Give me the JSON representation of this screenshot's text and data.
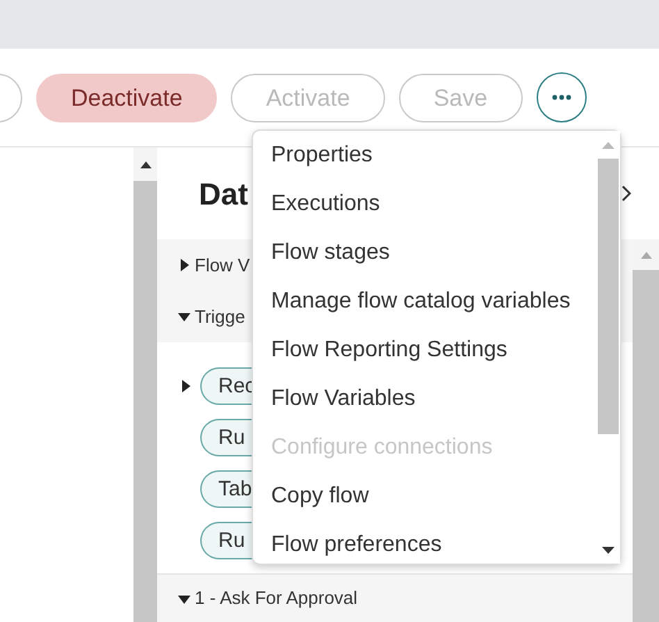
{
  "toolbar": {
    "buttons": [
      {
        "label": "Deactivate",
        "kind": "danger",
        "disabled": false
      },
      {
        "label": "Activate",
        "kind": "outline",
        "disabled": true
      },
      {
        "label": "Save",
        "kind": "outline",
        "disabled": true
      }
    ]
  },
  "panel": {
    "title": "Dat",
    "sections": [
      {
        "label": "Flow V",
        "expanded": false
      },
      {
        "label": "Trigge",
        "expanded": true
      }
    ],
    "triggers": [
      {
        "label": "Rec",
        "kind": "expandable",
        "expanded": false
      },
      {
        "label": "Ru",
        "kind": "plain"
      },
      {
        "label": "Tab",
        "kind": "plain"
      },
      {
        "label": "Ru",
        "kind": "plain"
      }
    ],
    "steps": [
      {
        "label": "1 - Ask For Approval",
        "expanded": true
      }
    ]
  },
  "menu": {
    "items": [
      {
        "label": "Properties",
        "disabled": false
      },
      {
        "label": "Executions",
        "disabled": false
      },
      {
        "label": "Flow stages",
        "disabled": false
      },
      {
        "label": "Manage flow catalog variables",
        "disabled": false
      },
      {
        "label": "Flow Reporting Settings",
        "disabled": false
      },
      {
        "label": "Flow Variables",
        "disabled": false
      },
      {
        "label": "Configure connections",
        "disabled": true
      },
      {
        "label": "Copy flow",
        "disabled": false
      },
      {
        "label": "Flow preferences",
        "disabled": false
      }
    ]
  }
}
